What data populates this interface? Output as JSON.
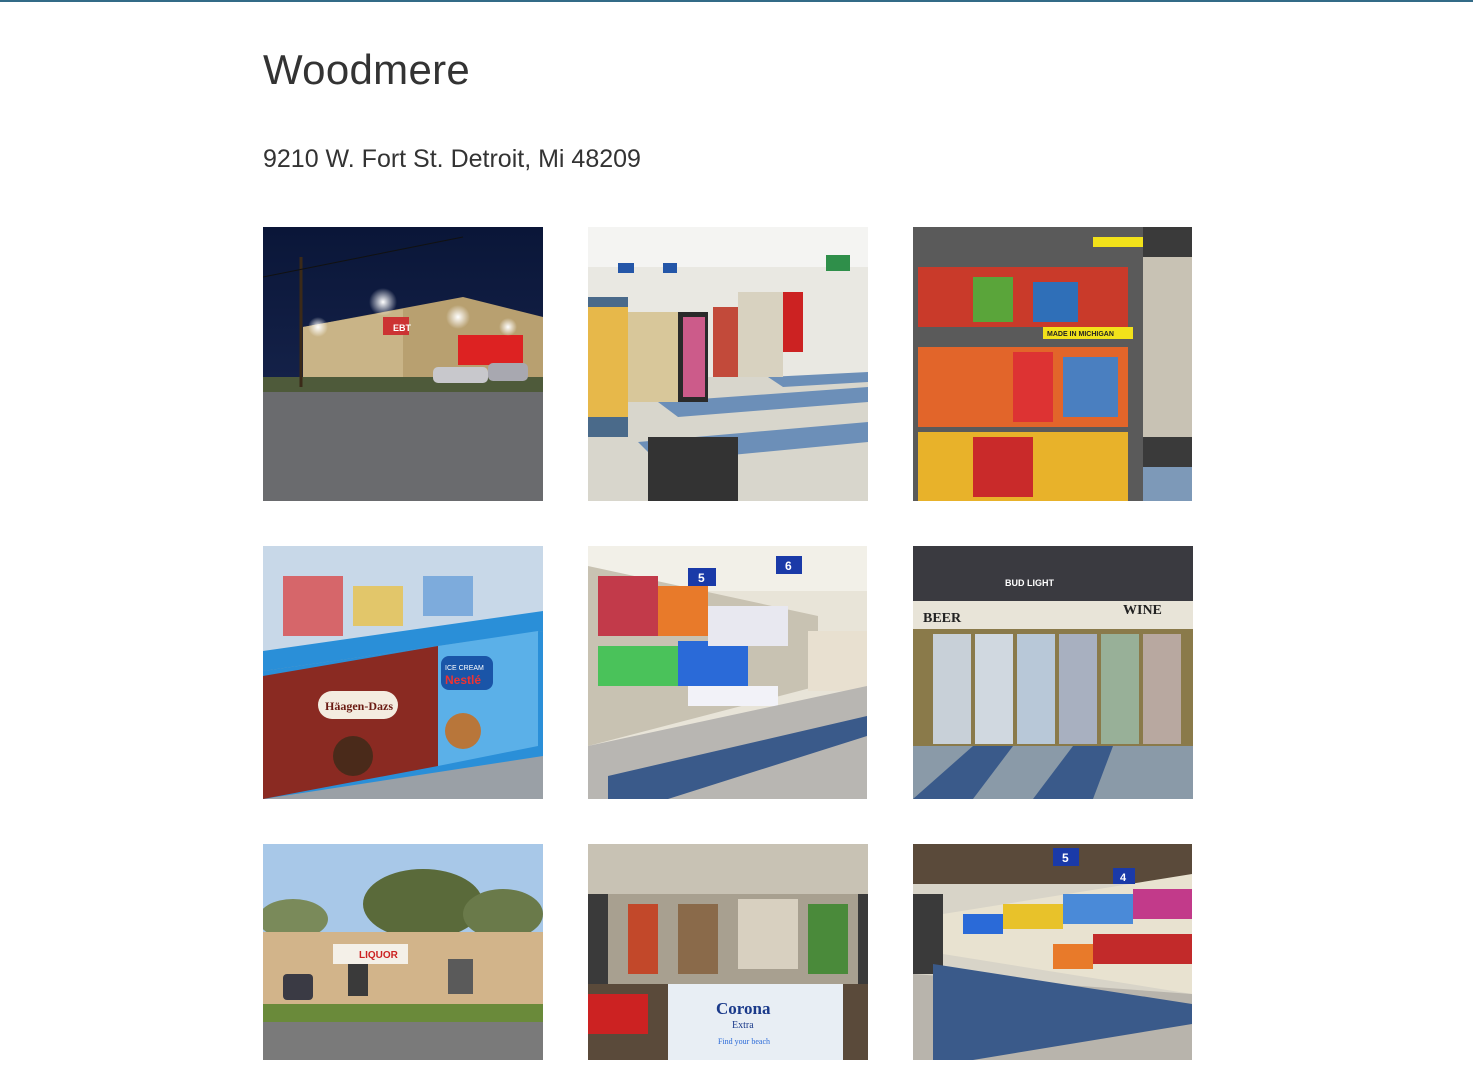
{
  "page": {
    "title": "Woodmere",
    "address": "9210 W. Fort St. Detroit, Mi 48209"
  },
  "colors": {
    "top_border": "#336b87",
    "text": "#333333"
  },
  "gallery": {
    "photos": [
      {
        "name": "photo-store-exterior-night",
        "sign_text": "EBT"
      },
      {
        "name": "photo-store-interior-aisles"
      },
      {
        "name": "photo-chips-rack",
        "sign_text": "MADE IN MICHIGAN"
      },
      {
        "name": "photo-ice-cream-freezer",
        "brands": [
          "Häagen-Dazs",
          "Nestlé",
          "ICE CREAM"
        ]
      },
      {
        "name": "photo-household-aisle",
        "aisle_numbers": [
          "5",
          "6"
        ]
      },
      {
        "name": "photo-beer-wine-coolers",
        "signs": [
          "BEER",
          "WINE",
          "BUD LIGHT"
        ]
      },
      {
        "name": "photo-store-exterior-day",
        "sign_text": "LIQUOR"
      },
      {
        "name": "photo-checkout-counter",
        "brands": [
          "Corona",
          "Extra",
          "Find your beach"
        ]
      },
      {
        "name": "photo-pet-food-aisle",
        "aisle_numbers": [
          "5",
          "4"
        ]
      }
    ]
  }
}
